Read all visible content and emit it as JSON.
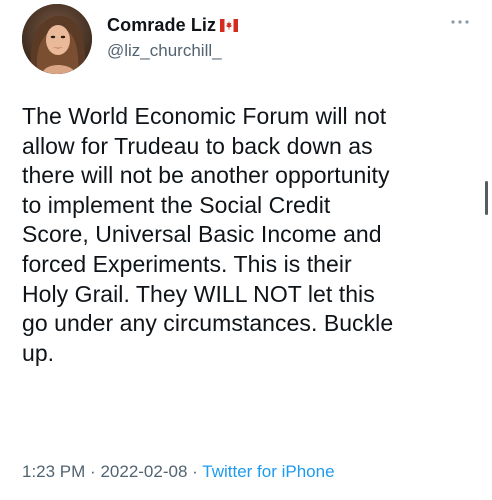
{
  "author": {
    "display_name": "Comrade Liz",
    "handle": "@liz_churchill_",
    "flag_icon": "canada-flag-icon",
    "avatar_icon": "profile-photo"
  },
  "more_icon": "more-dots-icon",
  "tweet": {
    "lines": [
      "The World Economic Forum will not",
      "allow for Trudeau to back down as",
      "there will not be another opportunity",
      "to implement the Social Credit",
      "Score, Universal Basic Income and",
      "forced Experiments. This is their",
      "Holy Grail. They WILL NOT let this",
      "go under any circumstances. Buckle",
      "up."
    ]
  },
  "meta": {
    "time": "1:23 PM",
    "separator": "·",
    "date": "2022-02-08",
    "source": "Twitter for iPhone"
  },
  "colors": {
    "text": "#0f1419",
    "secondary": "#536471",
    "link": "#1d9bf0",
    "flag_red": "#d52b1e"
  }
}
